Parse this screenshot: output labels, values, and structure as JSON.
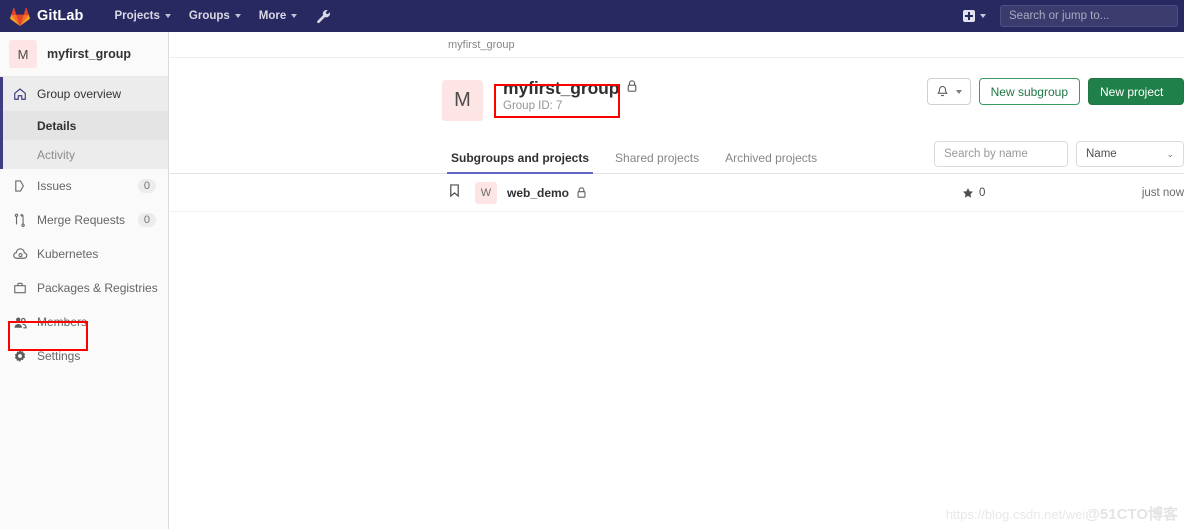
{
  "navbar": {
    "brand": "GitLab",
    "logo_icon": "gitlab-tanuki-icon",
    "links": [
      {
        "label": "Projects",
        "icon": "chevron-down-icon"
      },
      {
        "label": "Groups",
        "icon": "chevron-down-icon"
      },
      {
        "label": "More",
        "icon": "chevron-down-icon"
      }
    ],
    "wrench_icon": "wrench-icon",
    "plus_icon": "plus-square-icon",
    "plus_caret_icon": "chevron-down-icon",
    "search_placeholder": "Search or jump to...",
    "search_value": ""
  },
  "sidebar": {
    "group_initial": "M",
    "group_name": "myfirst_group",
    "overview": {
      "label": "Group overview",
      "icon": "home-icon"
    },
    "sub_items": [
      {
        "label": "Details",
        "active": true
      },
      {
        "label": "Activity",
        "active": false
      }
    ],
    "items": [
      {
        "label": "Issues",
        "icon": "issues-icon",
        "count": "0"
      },
      {
        "label": "Merge Requests",
        "icon": "merge-request-icon",
        "count": "0"
      },
      {
        "label": "Kubernetes",
        "icon": "kubernetes-icon",
        "count": ""
      },
      {
        "label": "Packages & Registries",
        "icon": "package-icon",
        "count": ""
      },
      {
        "label": "Members",
        "icon": "members-icon",
        "count": ""
      },
      {
        "label": "Settings",
        "icon": "gear-icon",
        "count": ""
      }
    ]
  },
  "main": {
    "breadcrumb": "myfirst_group",
    "group_initial": "M",
    "group_title": "myfirst_group",
    "group_lock_icon": "lock-icon",
    "group_id": "Group ID: 7",
    "actions": {
      "bell_icon": "bell-icon",
      "bell_caret_icon": "chevron-down-icon",
      "new_subgroup": "New subgroup",
      "new_project": "New project"
    },
    "tabs": [
      {
        "label": "Subgroups and projects",
        "active": true
      },
      {
        "label": "Shared projects",
        "active": false
      },
      {
        "label": "Archived projects",
        "active": false
      }
    ],
    "search_placeholder": "Search by name",
    "search_value": "",
    "sort_value": "Name",
    "sort_caret_icon": "chevron-down-icon",
    "projects": [
      {
        "bookmark_icon": "bookmark-icon",
        "initial": "W",
        "name": "web_demo",
        "lock_icon": "lock-icon",
        "star_icon": "star-icon",
        "stars": "0",
        "updated": "just now"
      }
    ]
  },
  "annotations": {
    "members_highlight": true,
    "title_highlight": true,
    "highlight_color": "#ff0000"
  },
  "watermark": {
    "url": "https://blog.csdn.net/wei",
    "brand": "@51CTO博客"
  }
}
